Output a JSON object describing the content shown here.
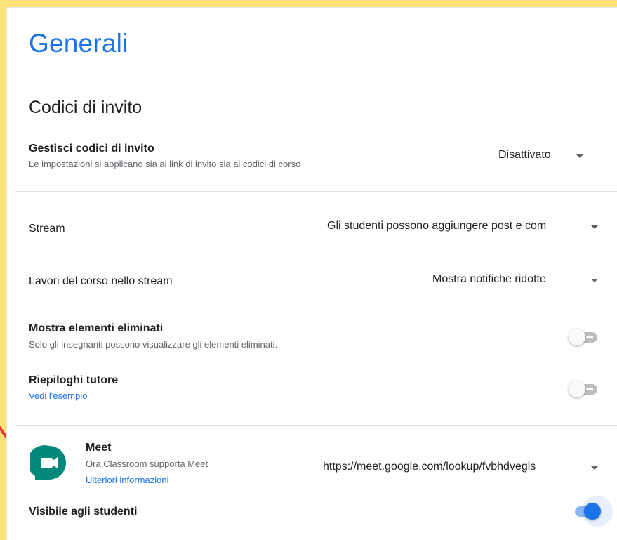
{
  "page": {
    "title": "Generali"
  },
  "invite": {
    "section_title": "Codici di invito",
    "label": "Gestisci codici di invito",
    "desc": "Le impostazioni si applicano sia ai link di invito sia ai codici di corso",
    "value": "Disattivato"
  },
  "stream": {
    "label": "Stream",
    "value": "Gli studenti possono aggiungere post e com"
  },
  "classwork": {
    "label": "Lavori del corso nello stream",
    "value": "Mostra notifiche ridotte"
  },
  "deleted": {
    "label": "Mostra elementi eliminati",
    "desc": "Solo gli insegnanti possono visualizzare gli elementi eliminati.",
    "enabled": false
  },
  "guardian": {
    "label": "Riepiloghi tutore",
    "link": "Vedi l'esempio",
    "enabled": false
  },
  "meet": {
    "title": "Meet",
    "desc": "Ora Classroom supporta Meet",
    "link": "Ulteriori informazioni",
    "url": "https://meet.google.com/lookup/fvbhdvegls",
    "visible_label": "Visibile agli studenti",
    "visible_enabled": true
  },
  "icons": {
    "dropdown": "caret-down-icon",
    "meet_logo": "google-meet-icon",
    "annotation": "red-arrow-icon"
  },
  "colors": {
    "accent": "#1a73e8",
    "background_frame": "#fde27a",
    "meet_green": "#00897b",
    "annotation": "#e53935"
  }
}
